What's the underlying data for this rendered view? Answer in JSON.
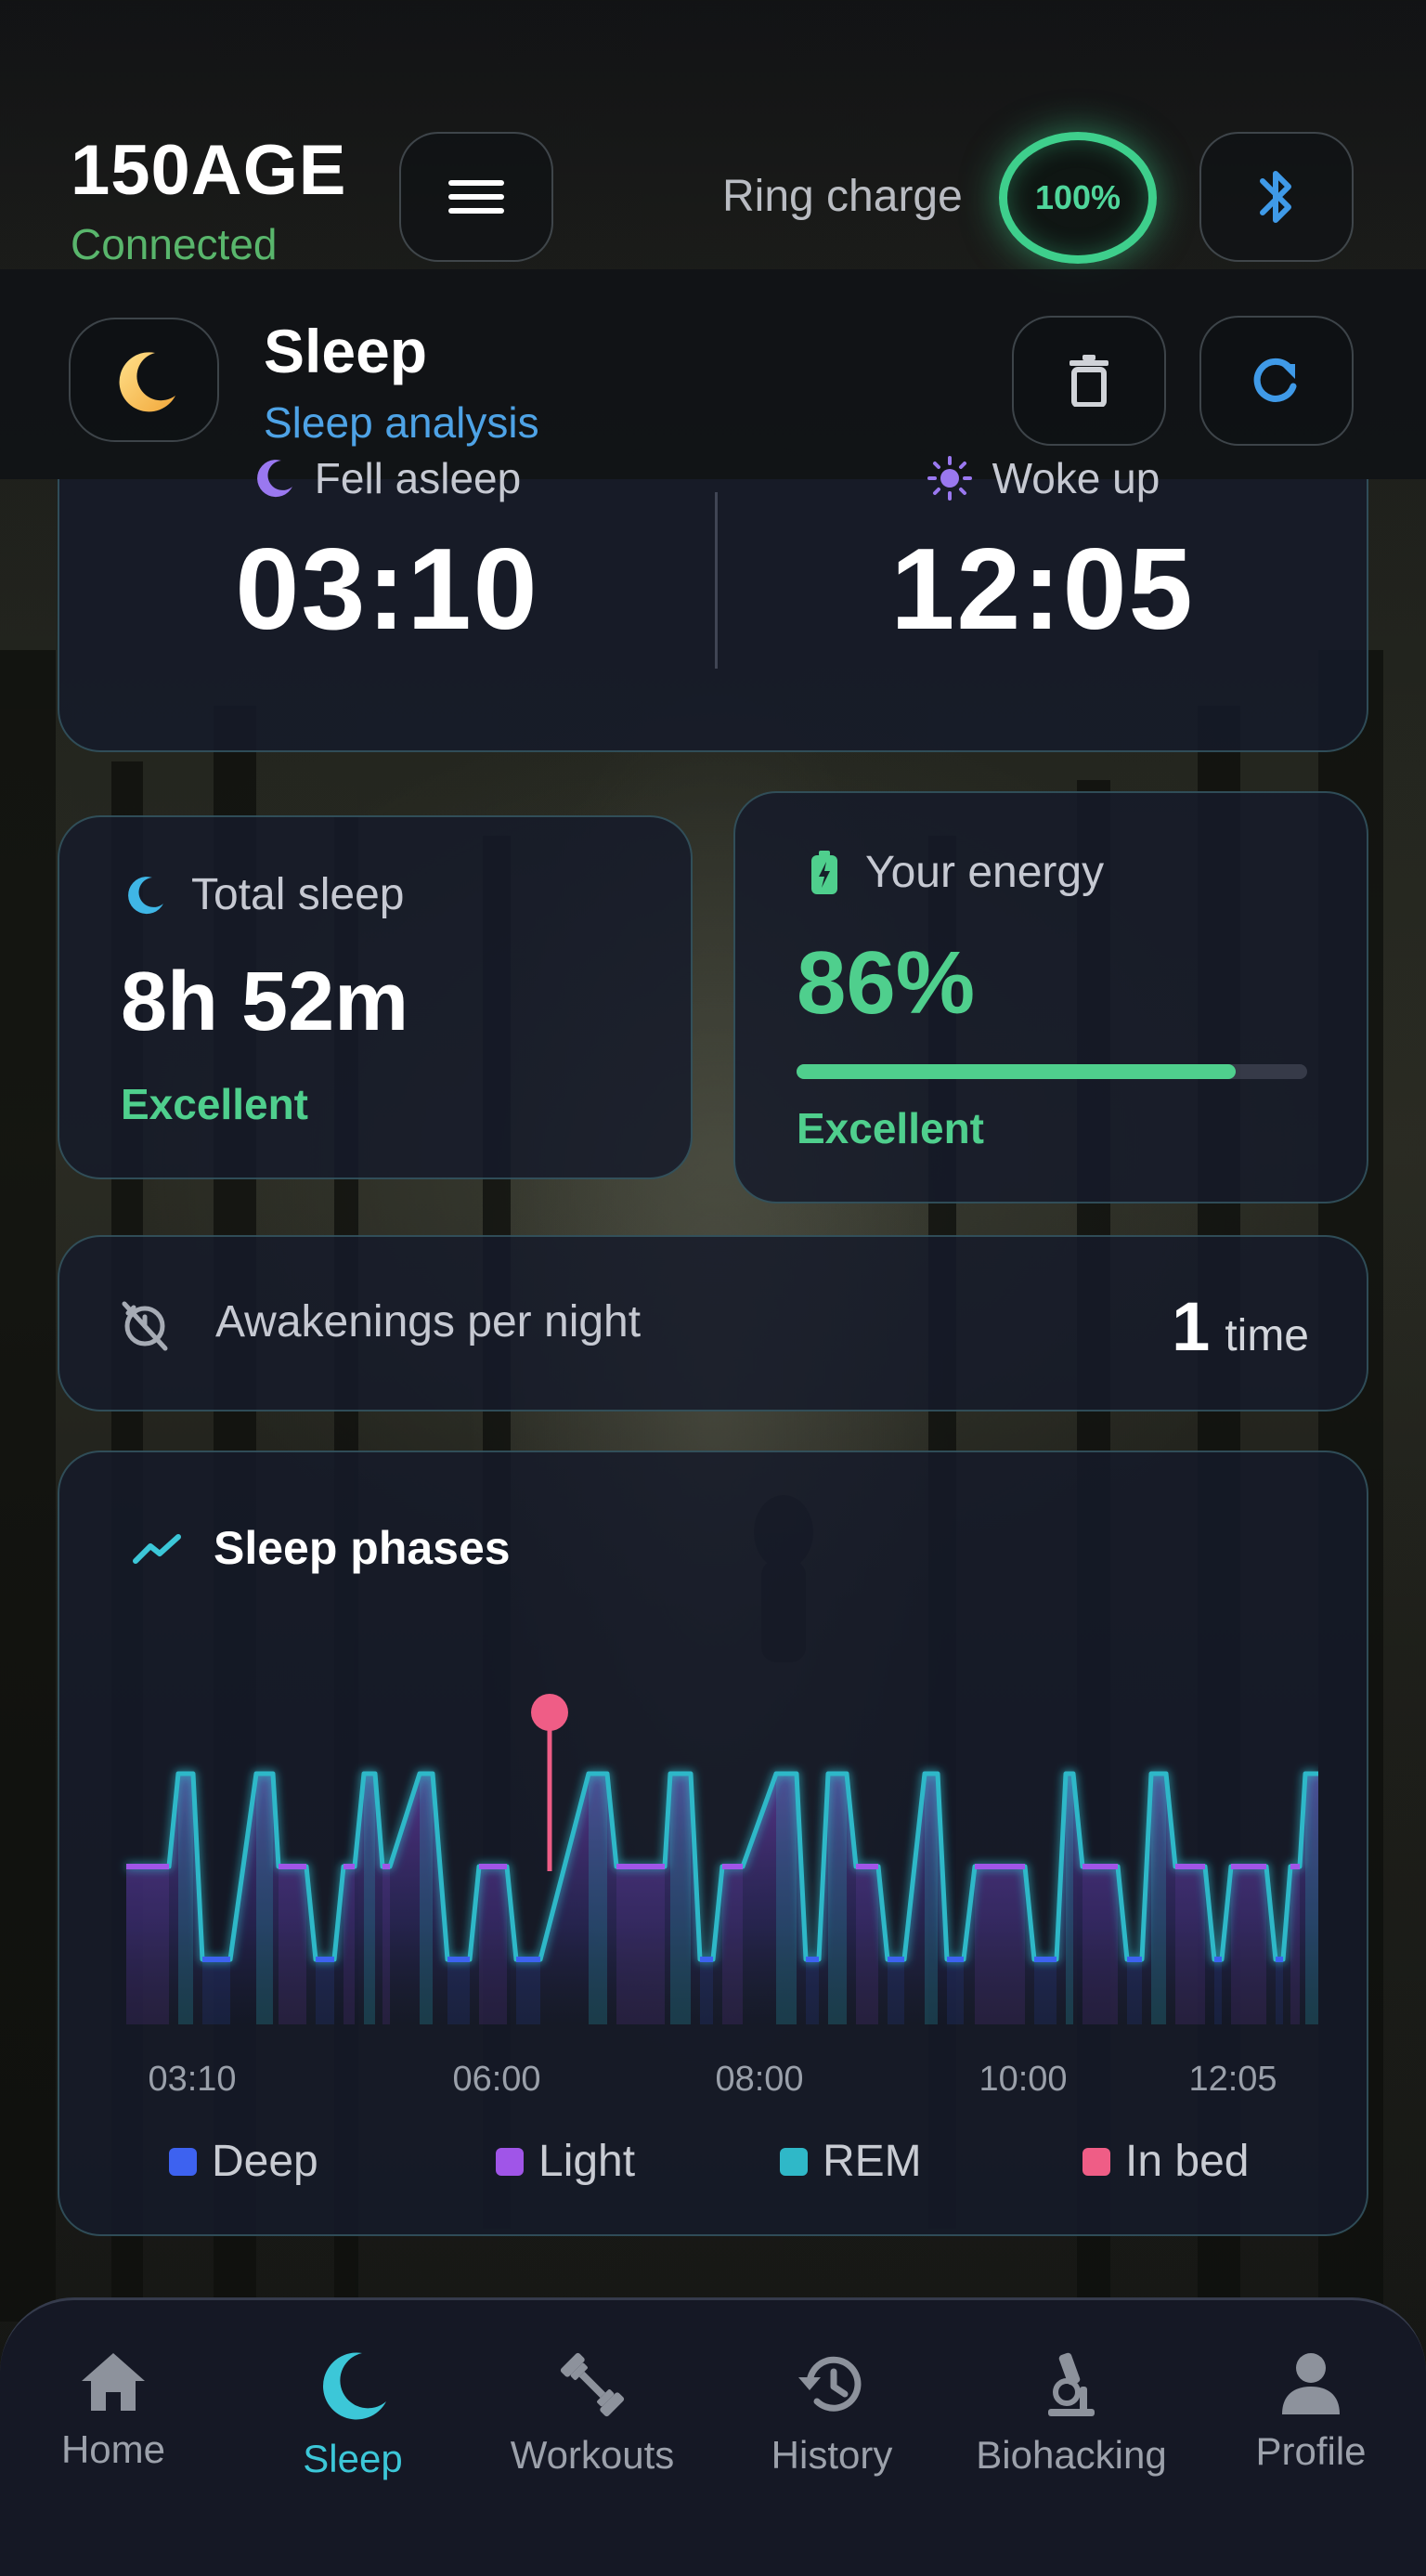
{
  "header": {
    "brand": "150AGE",
    "status": "Connected",
    "ring_label": "Ring charge",
    "ring_value": "100%",
    "ring_percent": 100
  },
  "section": {
    "title": "Sleep",
    "subtitle": "Sleep analysis"
  },
  "times": {
    "fell_asleep_label": "Fell asleep",
    "fell_asleep_value": "03:10",
    "woke_up_label": "Woke up",
    "woke_up_value": "12:05"
  },
  "total_sleep": {
    "label": "Total sleep",
    "value": "8h 52m",
    "rating": "Excellent"
  },
  "energy": {
    "label": "Your energy",
    "value": "86%",
    "percent": 86,
    "rating": "Excellent"
  },
  "awakenings": {
    "label": "Awakenings per night",
    "count": "1",
    "unit": "time"
  },
  "chart_data": {
    "type": "line",
    "title": "Sleep phases",
    "x_ticks": [
      "03:10",
      "06:00",
      "08:00",
      "10:00",
      "12:05"
    ],
    "legend": [
      {
        "name": "Deep",
        "color": "#3d62f0"
      },
      {
        "name": "Light",
        "color": "#a055e8"
      },
      {
        "name": "REM",
        "color": "#2fb8c8"
      },
      {
        "name": "In bed",
        "color": "#ef5d86"
      }
    ]
  },
  "nav": [
    {
      "label": "Home",
      "icon": "home-icon"
    },
    {
      "label": "Sleep",
      "icon": "moon-icon",
      "active": true
    },
    {
      "label": "Workouts",
      "icon": "dumbbell-icon"
    },
    {
      "label": "History",
      "icon": "history-icon"
    },
    {
      "label": "Biohacking",
      "icon": "microscope-icon"
    },
    {
      "label": "Profile",
      "icon": "profile-icon"
    }
  ]
}
